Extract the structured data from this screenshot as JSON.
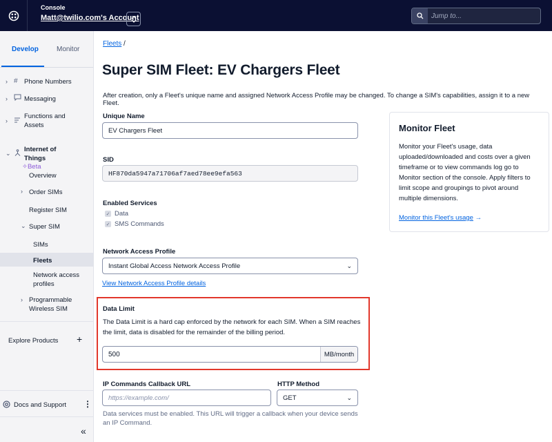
{
  "topbar": {
    "console_label": "Console",
    "account_label": "Matt@twilio.com's Account",
    "search_placeholder": "Jump to..."
  },
  "sidebar": {
    "tabs": [
      {
        "label": "Develop",
        "active": true
      },
      {
        "label": "Monitor",
        "active": false
      }
    ],
    "items": [
      {
        "label": "Phone Numbers",
        "icon": "hash-icon"
      },
      {
        "label": "Messaging",
        "icon": "chat-bubble-icon"
      },
      {
        "label": "Functions and Assets",
        "icon": "function-icon",
        "badge": "Beta"
      },
      {
        "label": "Internet of Things",
        "icon": "iot-icon",
        "expanded": true
      }
    ],
    "iot_children": {
      "overview": "Overview",
      "order_sims": "Order SIMs",
      "register_sim": "Register SIM",
      "super_sim": "Super SIM",
      "sims": "SIMs",
      "fleets": "Fleets",
      "network_access_profiles": "Network access profiles",
      "programmable_wireless_sim": "Programmable Wireless SIM"
    },
    "beta_badge": "✧Beta",
    "functions_label_line1": "Functions and",
    "functions_label_line2": "Assets",
    "iot_label_line1": "Internet of",
    "iot_label_line2": "Things",
    "nap_line1": "Network access",
    "nap_line2": "profiles",
    "pw_line1": "Programmable",
    "pw_line2": "Wireless SIM",
    "explore_products": "Explore Products",
    "docs_and_support": "Docs and Support"
  },
  "main": {
    "breadcrumb": "Fleets",
    "breadcrumb_sep": "/",
    "title": "Super SIM Fleet: EV Chargers Fleet",
    "intro": "After creation, only a Fleet's unique name and assigned Network Access Profile may be changed. To change a SIM's capabilities, assign it to a new Fleet.",
    "unique_name_label": "Unique Name",
    "unique_name_value": "EV Chargers Fleet",
    "sid_label": "SID",
    "sid_value": "HF870da5947a71706af7aed78ee9efa563",
    "enabled_services_label": "Enabled Services",
    "services": [
      "Data",
      "SMS Commands"
    ],
    "nap_label": "Network Access Profile",
    "nap_value": "Instant Global Access Network Access Profile",
    "nap_link": "View Network Access Profile details",
    "data_limit_label": "Data Limit",
    "data_limit_desc": "The Data Limit is a hard cap enforced by the network for each SIM. When a SIM reaches the limit, data is disabled for the remainder of the billing period.",
    "data_limit_value": "500",
    "data_limit_unit": "MB/month",
    "ip_callback_label": "IP Commands Callback URL",
    "ip_callback_placeholder": "https://example.com/",
    "http_method_label": "HTTP Method",
    "http_method_value": "GET",
    "helper": "Data services must be enabled. This URL will trigger a callback when your device sends an IP Command."
  },
  "monitor_card": {
    "title": "Monitor Fleet",
    "body": "Monitor your Fleet's usage, data uploaded/downloaded and costs over a given timeframe or to view commands log go to Monitor section of the console. Apply filters to limit scope and groupings to pivot around multiple dimensions.",
    "link": "Monitor this Fleet's usage",
    "link_arrow": "→"
  },
  "colors": {
    "topbar_bg": "#0b1033",
    "accent": "#0263e0",
    "highlight": "#e2372b"
  }
}
